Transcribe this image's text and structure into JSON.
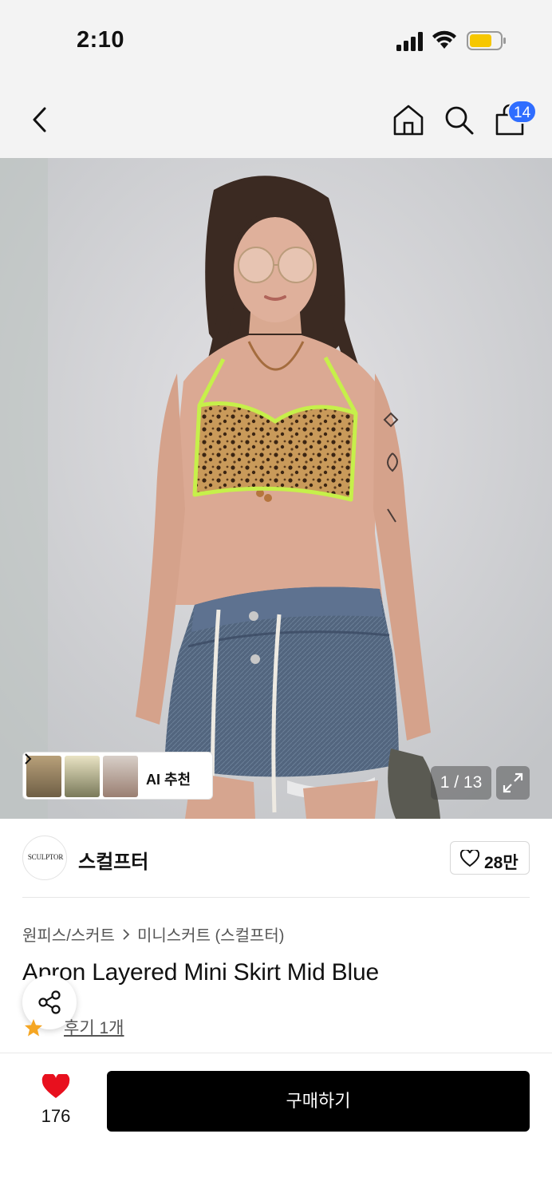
{
  "status_bar": {
    "time": "2:10"
  },
  "nav": {
    "cart_count": "14"
  },
  "gallery": {
    "ai_label": "AI 추천",
    "page_counter": "1 / 13"
  },
  "brand": {
    "logo_text": "SCULPTOR",
    "name": "스컬프터",
    "like_count": "28만"
  },
  "product": {
    "breadcrumb": [
      "원피스/스커트",
      "미니스커트 (스컬프터)"
    ],
    "title": "Apron Layered Mini Skirt Mid Blue",
    "review_text": "후기 1개"
  },
  "bottom_bar": {
    "like_count": "176",
    "buy_label": "구매하기"
  },
  "colors": {
    "accent_blue": "#2f6dff",
    "heart_red": "#e8101e",
    "star_orange": "#f5a623",
    "buy_button": "#000000"
  }
}
